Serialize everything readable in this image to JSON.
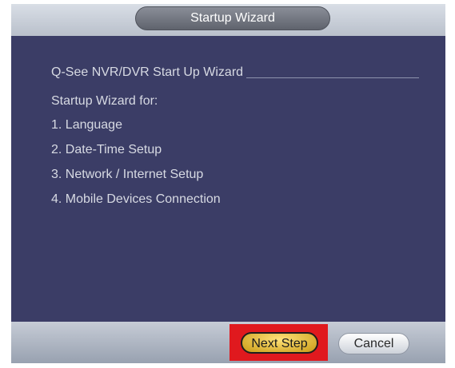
{
  "window": {
    "title": "Startup Wizard"
  },
  "content": {
    "heading": "Q-See NVR/DVR Start Up Wizard",
    "intro": "Startup Wizard for:",
    "steps": [
      "1. Language",
      "2. Date-Time Setup",
      "3. Network / Internet Setup",
      "4. Mobile Devices Connection"
    ]
  },
  "footer": {
    "next_label": "Next Step",
    "cancel_label": "Cancel"
  },
  "colors": {
    "panel_background": "#3b3d66",
    "highlight_frame": "#e0191e",
    "next_button": "#f0c23a"
  }
}
